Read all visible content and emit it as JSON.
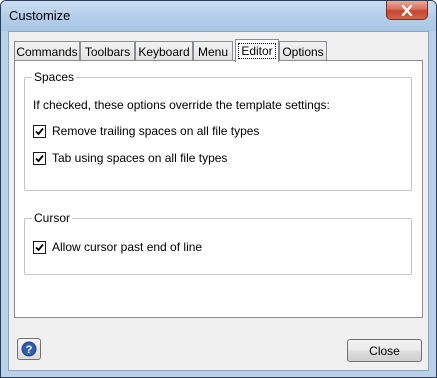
{
  "window": {
    "title": "Customize"
  },
  "tabs": [
    {
      "label": "Commands",
      "active": false
    },
    {
      "label": "Toolbars",
      "active": false
    },
    {
      "label": "Keyboard",
      "active": false
    },
    {
      "label": "Menu",
      "active": false
    },
    {
      "label": "Editor",
      "active": true
    },
    {
      "label": "Options",
      "active": false
    }
  ],
  "spaces": {
    "title": "Spaces",
    "description": "If checked, these options override the template settings:",
    "options": [
      {
        "label": "Remove trailing spaces on all file types",
        "checked": true
      },
      {
        "label": "Tab using spaces on all file types",
        "checked": true
      }
    ]
  },
  "cursor": {
    "title": "Cursor",
    "options": [
      {
        "label": "Allow cursor past end of line",
        "checked": true
      }
    ]
  },
  "footer": {
    "close_label": "Close",
    "help_icon": "help-icon"
  },
  "colors": {
    "window_frame": "#b9d1ea",
    "close_button_red": "#c4452d",
    "dialog_bg": "#f0f0f0",
    "help_icon_blue": "#2f5fb3"
  }
}
